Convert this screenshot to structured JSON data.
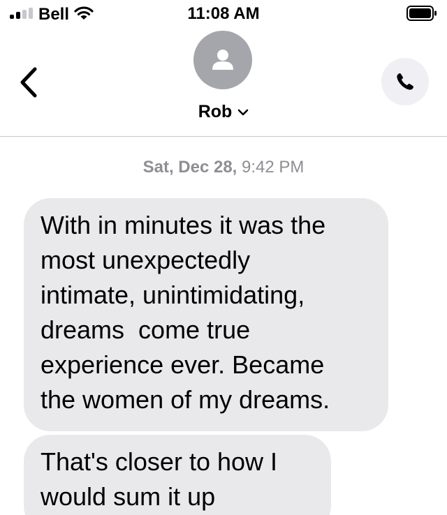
{
  "status_bar": {
    "carrier": "Bell",
    "time": "11:08 AM",
    "signal_bars_filled": 2,
    "signal_bars_total": 4,
    "icons": [
      "signal-icon",
      "wifi-icon",
      "battery-icon"
    ]
  },
  "header": {
    "contact_name": "Rob",
    "icons": [
      "back-chevron-icon",
      "person-icon",
      "chevron-down-icon",
      "phone-icon"
    ]
  },
  "conversation": {
    "timestamp_date": "Sat, Dec 28,",
    "timestamp_time": "9:42 PM",
    "messages": [
      {
        "direction": "incoming",
        "lines": [
          "With in minutes it was the",
          "most unexpectedly",
          "intimate, unintimidating,",
          "dreams  come true",
          "experience ever. Became",
          "the women of my dreams."
        ]
      },
      {
        "direction": "incoming",
        "lines": [
          "That's closer to how I",
          "would sum it up"
        ]
      }
    ]
  },
  "colors": {
    "incoming_bubble": "#e9e9eb",
    "avatar_bg": "#a5a6ac",
    "timestamp_text": "#8e8e93",
    "call_button_bg": "#efeff4"
  }
}
